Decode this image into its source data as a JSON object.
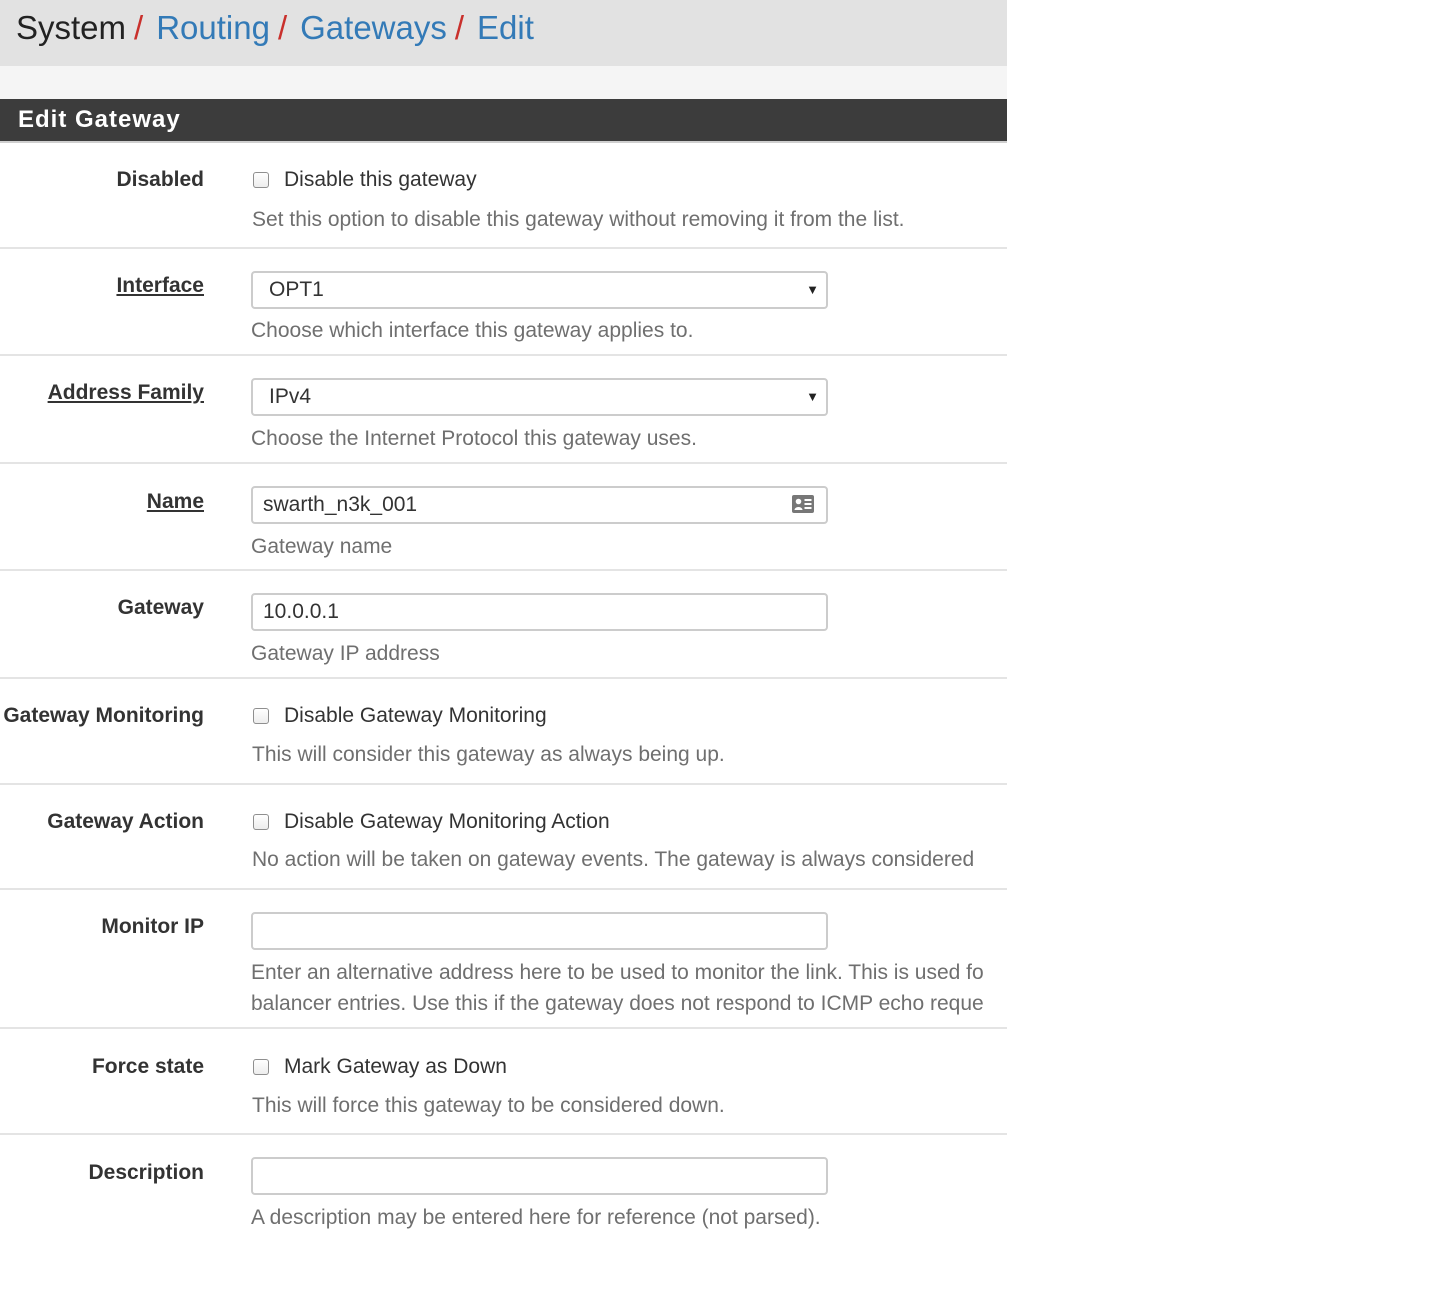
{
  "breadcrumb": {
    "root": "System",
    "separator": "/",
    "items": [
      "Routing",
      "Gateways",
      "Edit"
    ]
  },
  "panel": {
    "title": "Edit Gateway"
  },
  "form": {
    "disabled": {
      "label": "Disabled",
      "checkbox_label": "Disable this gateway",
      "checked": false,
      "help": "Set this option to disable this gateway without removing it from the list."
    },
    "interface": {
      "label": "Interface",
      "value": "OPT1",
      "help": "Choose which interface this gateway applies to."
    },
    "address_family": {
      "label": "Address Family",
      "value": "IPv4",
      "help": "Choose the Internet Protocol this gateway uses."
    },
    "name": {
      "label": "Name",
      "value": "swarth_n3k_001",
      "help": "Gateway name"
    },
    "gateway": {
      "label": "Gateway",
      "value": "10.0.0.1",
      "help": "Gateway IP address"
    },
    "gateway_monitoring": {
      "label": "Gateway Monitoring",
      "checkbox_label": "Disable Gateway Monitoring",
      "checked": false,
      "help": "This will consider this gateway as always being up."
    },
    "gateway_action": {
      "label": "Gateway Action",
      "checkbox_label": "Disable Gateway Monitoring Action",
      "checked": false,
      "help": "No action will be taken on gateway events. The gateway is always considered"
    },
    "monitor_ip": {
      "label": "Monitor IP",
      "value": "",
      "help_line1": "Enter an alternative address here to be used to monitor the link. This is used fo",
      "help_line2": "balancer entries. Use this if the gateway does not respond to ICMP echo reque"
    },
    "force_state": {
      "label": "Force state",
      "checkbox_label": "Mark Gateway as Down",
      "checked": false,
      "help": "This will force this gateway to be considered down."
    },
    "description": {
      "label": "Description",
      "value": "",
      "help": "A description may be entered here for reference (not parsed)."
    }
  },
  "icons": {
    "select_caret": "caret-down-icon",
    "name_field": "contact-card-icon"
  },
  "colors": {
    "breadcrumb_bg": "#e2e2e2",
    "breadcrumb_separator": "#c9302c",
    "link": "#337ab7",
    "panel_heading_bg": "#3c3c3c",
    "help_text": "#6f6f6f"
  }
}
